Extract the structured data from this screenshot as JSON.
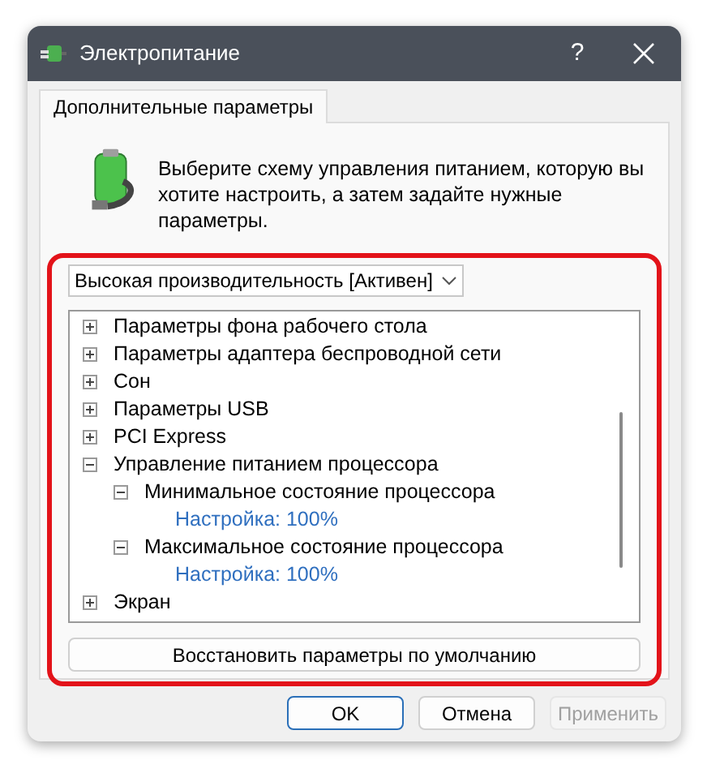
{
  "window": {
    "title": "Электропитание",
    "help_button": "?"
  },
  "tabs": [
    {
      "label": "Дополнительные параметры",
      "selected": true
    }
  ],
  "description": "Выберите схему управления питанием, которую вы хотите настроить, а затем задайте нужные параметры.",
  "plan_dropdown": {
    "value": "Высокая производительность [Активен]"
  },
  "tree": [
    {
      "kind": "group",
      "label": "Параметры фона рабочего стола",
      "expanded": false
    },
    {
      "kind": "group",
      "label": "Параметры адаптера беспроводной сети",
      "expanded": false
    },
    {
      "kind": "group",
      "label": "Сон",
      "expanded": false
    },
    {
      "kind": "group",
      "label": "Параметры USB",
      "expanded": false
    },
    {
      "kind": "group",
      "label": "PCI Express",
      "expanded": false
    },
    {
      "kind": "group",
      "label": "Управление питанием процессора",
      "expanded": true,
      "children": [
        {
          "kind": "group",
          "label": "Минимальное состояние процессора",
          "expanded": true,
          "children": [
            {
              "kind": "value",
              "label": "Настройка: 100%"
            }
          ]
        },
        {
          "kind": "group",
          "label": "Максимальное состояние процессора",
          "expanded": true,
          "children": [
            {
              "kind": "value",
              "label": "Настройка: 100%"
            }
          ]
        }
      ]
    },
    {
      "kind": "group",
      "label": "Экран",
      "expanded": false
    }
  ],
  "restore_button": "Восстановить параметры по умолчанию",
  "buttons": [
    {
      "label": "OK",
      "default": true,
      "disabled": false
    },
    {
      "label": "Отмена",
      "default": false,
      "disabled": false
    },
    {
      "label": "Применить",
      "default": false,
      "disabled": true
    }
  ]
}
